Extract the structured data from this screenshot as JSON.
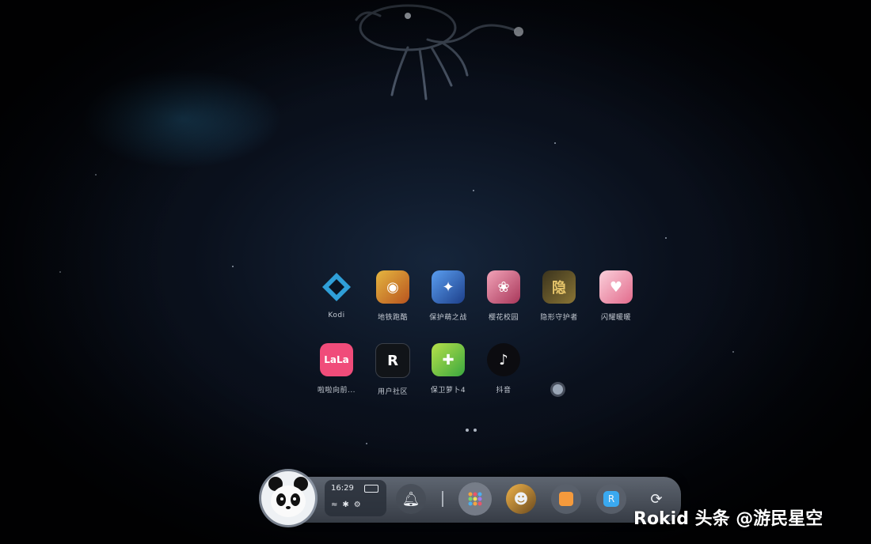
{
  "apps": [
    {
      "label": "Kodi",
      "icon": "kodi-icon",
      "color": "#2f9fd8"
    },
    {
      "label": "地铁跑酷",
      "icon": "subway-surfers-icon",
      "color": "#d9a13a"
    },
    {
      "label": "保护萌之战",
      "icon": "cute-battle-icon",
      "color": "#3d7ed6"
    },
    {
      "label": "樱花校园",
      "icon": "anime-girl-icon",
      "color": "#d8678c"
    },
    {
      "label": "隐形守护者",
      "icon": "invisible-guardian-icon",
      "color": "#6b5a2a"
    },
    {
      "label": "闪耀暖暖",
      "icon": "shining-nikki-icon",
      "color": "#f09ab1"
    },
    {
      "label": "啦啦向前...",
      "icon": "lala-icon",
      "color": "#f04c7a"
    },
    {
      "label": "用户社区",
      "icon": "rokid-community-icon",
      "color": "#111418"
    },
    {
      "label": "保卫萝卜4",
      "icon": "carrot-defense-icon",
      "color": "#8fcf3a"
    },
    {
      "label": "抖音",
      "icon": "tiktok-icon",
      "color": "#0c0c10"
    }
  ],
  "status": {
    "time": "16:29",
    "icons": "wifi bluetooth settings"
  },
  "dock": {
    "bell_icon": "bell-icon",
    "apps_icon": "app-grid-icon",
    "refresh_icon": "refresh-icon"
  },
  "watermark": "Rokid 头条 @游民星空"
}
